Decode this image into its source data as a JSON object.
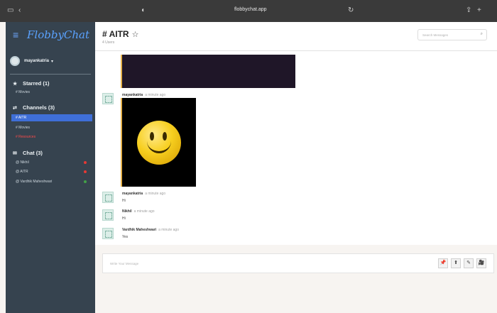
{
  "browser": {
    "url": "flobbychat.app",
    "icons": [
      "sidebar-toggle-icon",
      "back-icon",
      "shield-icon",
      "reload-icon",
      "share-icon",
      "new-tab-icon"
    ]
  },
  "sidebar": {
    "brand": "FlobbyChat",
    "user": {
      "name": "mayankatria",
      "caret": "▾"
    },
    "starred": {
      "label": "Starred (1)",
      "items": [
        "# Movies"
      ]
    },
    "channels": {
      "label": "Channels (3)",
      "items": [
        {
          "label": "# AITR",
          "state": "active"
        },
        {
          "label": "# Movies",
          "state": "normal"
        },
        {
          "label": "# Resources",
          "state": "alert"
        }
      ]
    },
    "direct": {
      "label": "Chat (3)",
      "items": [
        {
          "label": "@ Nikhil",
          "status": "#e53935"
        },
        {
          "label": "@ AITR",
          "status": "#e53935"
        },
        {
          "label": "@ Vardhik Maheshwari",
          "status": "#43a047"
        }
      ]
    }
  },
  "channel": {
    "title": "# AITR",
    "users": "4 Users"
  },
  "search": {
    "placeholder": "Search Messages"
  },
  "messages": [
    {
      "author": "mayankatria",
      "time": "a minute ago",
      "type": "image"
    },
    {
      "author": "mayankatria",
      "time": "a minute ago",
      "text": "Hi"
    },
    {
      "author": "Nikhil",
      "time": "a minute ago",
      "text": "Hi"
    },
    {
      "author": "Vardhik Maheshwari",
      "time": "a minute ago",
      "text": "Yes"
    }
  ],
  "composer": {
    "placeholder": "Write Your Message",
    "tools": [
      {
        "icon": "pin-icon",
        "glyph": "📌"
      },
      {
        "icon": "upload-icon",
        "glyph": "⬆"
      },
      {
        "icon": "edit-icon",
        "glyph": "✎"
      },
      {
        "icon": "video-icon",
        "glyph": "🎥"
      }
    ]
  },
  "colors": {
    "sidebar": "#36434f",
    "active": "#3f6fd8",
    "brand": "#5aa2ff",
    "alert": "#ff4a4a",
    "online": "#43a047",
    "offline": "#e53935"
  }
}
